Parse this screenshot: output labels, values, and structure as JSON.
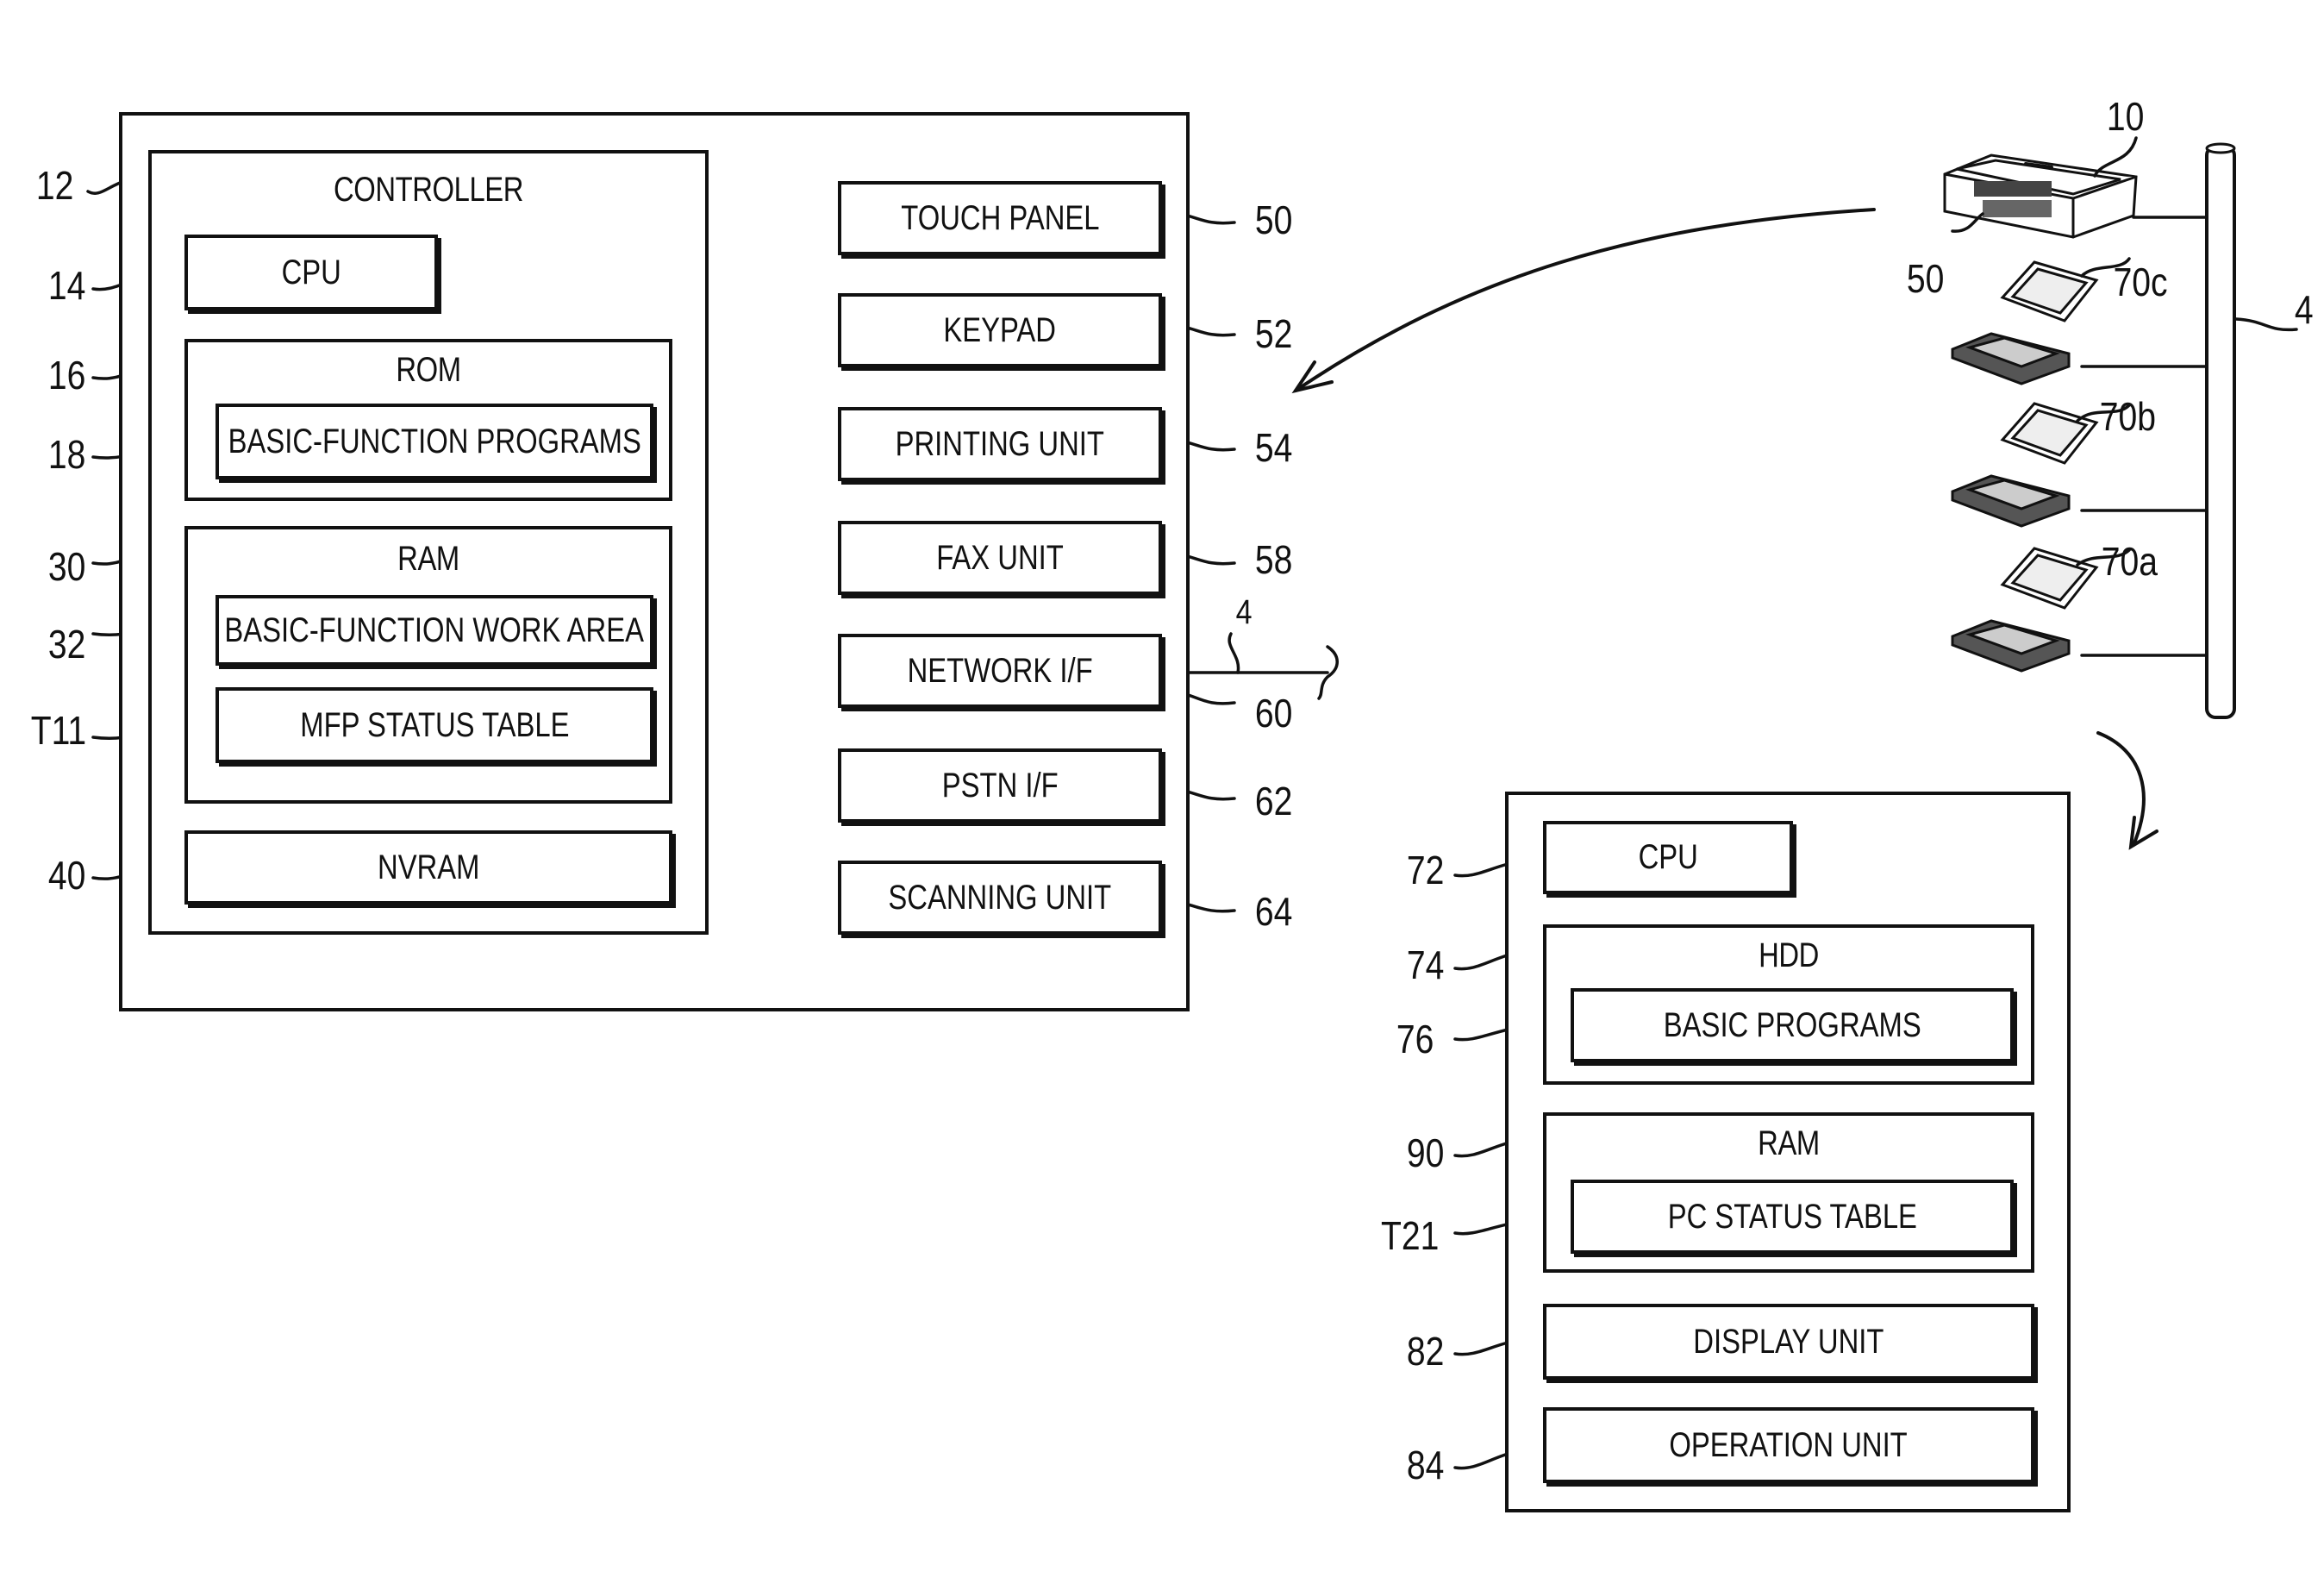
{
  "mfp": {
    "outer_ref": "12",
    "controller": {
      "title": "CONTROLLER",
      "cpu": {
        "label": "CPU",
        "ref": "14"
      },
      "rom": {
        "label": "ROM",
        "ref": "16",
        "child": {
          "label": "BASIC-FUNCTION PROGRAMS",
          "ref": "18"
        }
      },
      "ram": {
        "label": "RAM",
        "ref": "30",
        "children": [
          {
            "label": "BASIC-FUNCTION WORK AREA",
            "ref": "32"
          },
          {
            "label": "MFP STATUS TABLE",
            "ref": "T11"
          }
        ]
      },
      "nvram": {
        "label": "NVRAM",
        "ref": "40"
      }
    },
    "peripherals": [
      {
        "label": "TOUCH PANEL",
        "ref": "50"
      },
      {
        "label": "KEYPAD",
        "ref": "52"
      },
      {
        "label": "PRINTING UNIT",
        "ref": "54"
      },
      {
        "label": "FAX UNIT",
        "ref": "58"
      },
      {
        "label": "NETWORK I/F",
        "ref": "60"
      },
      {
        "label": "PSTN I/F",
        "ref": "62"
      },
      {
        "label": "SCANNING UNIT",
        "ref": "64"
      }
    ],
    "network_ref": "4"
  },
  "network": {
    "mfp_ref": "10",
    "touch_panel_ref": "50",
    "bus_ref": "4",
    "pcs": [
      "70c",
      "70b",
      "70a"
    ]
  },
  "pc": {
    "cpu": {
      "label": "CPU",
      "ref": "72"
    },
    "hdd": {
      "label": "HDD",
      "ref": "74",
      "child": {
        "label": "BASIC PROGRAMS",
        "ref": "76"
      }
    },
    "ram": {
      "label": "RAM",
      "ref": "90",
      "child": {
        "label": "PC STATUS TABLE",
        "ref": "T21"
      }
    },
    "display": {
      "label": "DISPLAY UNIT",
      "ref": "82"
    },
    "operation": {
      "label": "OPERATION UNIT",
      "ref": "84"
    }
  }
}
